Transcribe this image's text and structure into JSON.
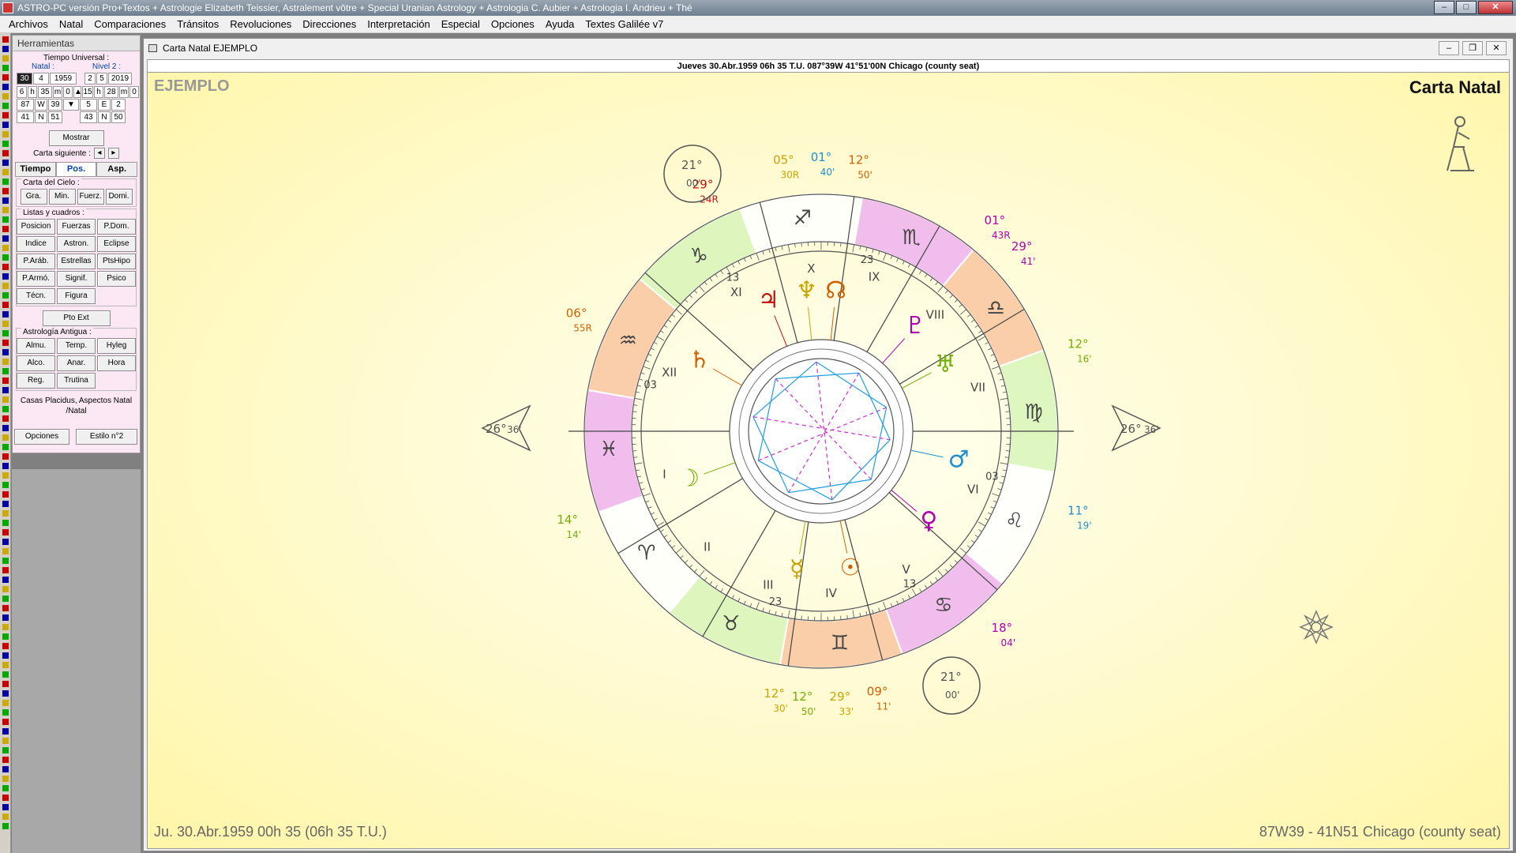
{
  "app": {
    "title": "ASTRO-PC versión Pro+Textos + Astrologie Elizabeth Teissier, Astralement vôtre + Special Uranian Astrology + Astrologia C. Aubier + Astrologia I. Andrieu + Thé"
  },
  "menu": [
    "Archivos",
    "Natal",
    "Comparaciones",
    "Tránsitos",
    "Revoluciones",
    "Direcciones",
    "Interpretación",
    "Especial",
    "Opciones",
    "Ayuda",
    "Textes Galilée v7"
  ],
  "tools": {
    "title": "Herramientas",
    "tiempo_label": "Tiempo Universal :",
    "natal_label": "Natal :",
    "nivel_label": "Nivel 2 :",
    "natal_date": [
      "30",
      "4",
      "1959"
    ],
    "nivel_date": [
      "2",
      "5",
      "2019"
    ],
    "natal_time": [
      "6",
      "h",
      "35",
      "m",
      "0"
    ],
    "nivel_time": [
      "15",
      "h",
      "28",
      "m",
      "0"
    ],
    "natal_lon": [
      "87",
      "W",
      "39"
    ],
    "nivel_lon": [
      "5",
      "E",
      "2"
    ],
    "natal_lat": [
      "41",
      "N",
      "51"
    ],
    "nivel_lat": [
      "43",
      "N",
      "50"
    ],
    "mostrar": "Mostrar",
    "siguiente": "Carta siguiente :",
    "tabs": [
      "Tiempo",
      "Pos.",
      "Asp."
    ],
    "cielo_label": "Carta del Cielo :",
    "cielo_btns": [
      "Gra.",
      "Min.",
      "Fuerz.",
      "Domi."
    ],
    "listas_label": "Listas y cuadros :",
    "listas_btns": [
      "Posicion",
      "Fuerzas",
      "P.Dom.",
      "Indice",
      "Astron.",
      "Eclipse",
      "P.Aráb.",
      "Estrellas",
      "PtsHipo",
      "P.Armó.",
      "Signif.",
      "Psico",
      "Técn.",
      "Figura"
    ],
    "ptoext": "Pto Ext",
    "antigua_label": "Astrología Antigua :",
    "antigua_btns": [
      "Almu.",
      "Temp.",
      "Hyleg",
      "Alco.",
      "Anar.",
      "Hora",
      "Reg.",
      "Trutina"
    ],
    "casas": "Casas Placidus, Aspectos Natal /Natal",
    "opciones": "Opciones",
    "estilo": "Estilo n°2"
  },
  "window": {
    "title": "Carta Natal  EJEMPLO"
  },
  "chart": {
    "info": "Jueves 30.Abr.1959 06h 35 T.U. 087°39W 41°51'00N  Chicago (county seat)",
    "name": "EJEMPLO",
    "title": "Carta Natal",
    "date_footer": "Ju. 30.Abr.1959 00h 35 (06h 35 T.U.)",
    "loc_footer": "87W39 - 41N51  Chicago (county seat)",
    "house_numerals": [
      "I",
      "II",
      "III",
      "IV",
      "V",
      "VI",
      "VII",
      "VIII",
      "IX",
      "X",
      "XI",
      "XII"
    ],
    "cusp_degrees": [
      "03",
      "13",
      "23",
      "03",
      "13",
      "23"
    ],
    "asc_label": {
      "deg": "26°",
      "min": "36'"
    },
    "dsc_label": {
      "deg": "26°",
      "min": "36'"
    },
    "mc_circle": {
      "deg": "21°",
      "min": "00'"
    },
    "ic_circle": {
      "deg": "21°",
      "min": "00'"
    },
    "outer_labels": [
      {
        "deg": "05°",
        "min": "30R",
        "color": "#c8a400"
      },
      {
        "deg": "01°",
        "min": "40'",
        "color": "#1e90d0"
      },
      {
        "deg": "12°",
        "min": "50'",
        "color": "#d06000"
      },
      {
        "deg": "29°",
        "min": "24R",
        "color": "#c01010"
      },
      {
        "deg": "01°",
        "min": "43R",
        "color": "#b000b0"
      },
      {
        "deg": "29°",
        "min": "41'",
        "color": "#b000b0"
      },
      {
        "deg": "06°",
        "min": "55R",
        "color": "#d06000"
      },
      {
        "deg": "12°",
        "min": "16'",
        "color": "#70b000"
      },
      {
        "deg": "14°",
        "min": "14'",
        "color": "#70b000"
      },
      {
        "deg": "11°",
        "min": "19'",
        "color": "#1e90d0"
      },
      {
        "deg": "18°",
        "min": "04'",
        "color": "#b000b0"
      },
      {
        "deg": "12°",
        "min": "30'",
        "color": "#c8a400"
      },
      {
        "deg": "12°",
        "min": "50'",
        "color": "#70b000"
      },
      {
        "deg": "29°",
        "min": "33'",
        "color": "#c8a400"
      },
      {
        "deg": "09°",
        "min": "11'",
        "color": "#d06000"
      }
    ],
    "colors": {
      "fire": "#f9c6a0",
      "earth": "#d8f5b8",
      "air": "#ffffff",
      "water": "#efb2ef",
      "aspect_blue": "#1e9ee0",
      "aspect_magenta": "#d030d0"
    }
  }
}
